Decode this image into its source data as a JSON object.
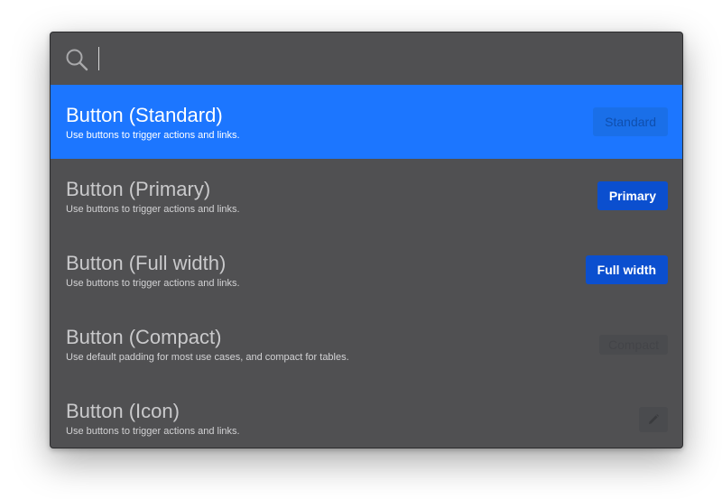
{
  "search": {
    "value": "",
    "placeholder": ""
  },
  "results": [
    {
      "title": "Button (Standard)",
      "description": "Use buttons to trigger actions and links.",
      "preview_label": "Standard",
      "selected": true
    },
    {
      "title": "Button (Primary)",
      "description": "Use buttons to trigger actions and links.",
      "preview_label": "Primary",
      "selected": false
    },
    {
      "title": "Button (Full width)",
      "description": "Use buttons to trigger actions and links.",
      "preview_label": "Full width",
      "selected": false
    },
    {
      "title": "Button (Compact)",
      "description": "Use default padding for most use cases, and compact for tables.",
      "preview_label": "Compact",
      "selected": false
    },
    {
      "title": "Button (Icon)",
      "description": "Use buttons to trigger actions and links.",
      "preview_icon": "pencil-icon",
      "selected": false
    }
  ],
  "colors": {
    "panel_bg": "#505052",
    "selected_bg": "#1c76ff",
    "primary_button": "#0b4fcf"
  },
  "icons": {
    "search": "search-icon",
    "edit": "pencil-icon"
  }
}
